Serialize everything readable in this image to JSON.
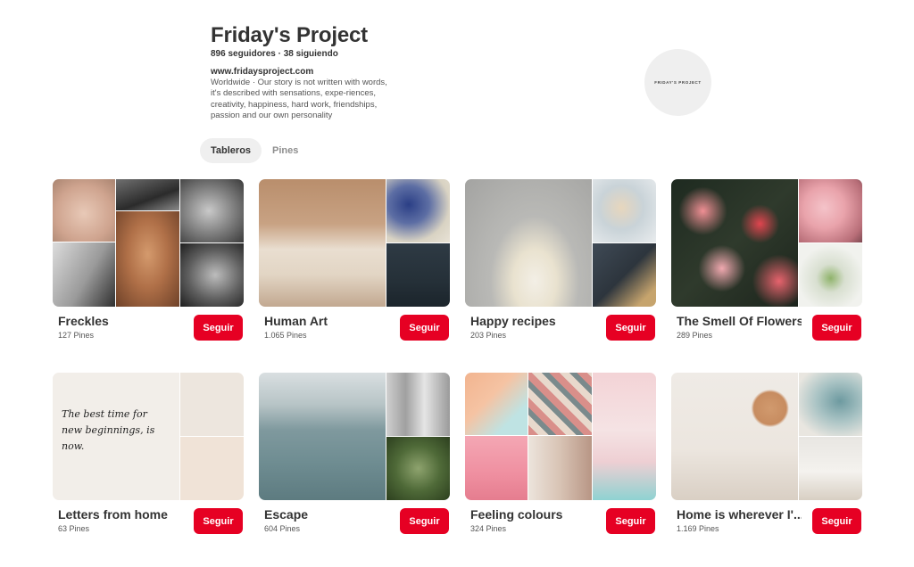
{
  "profile": {
    "name": "Friday's Project",
    "stats": "896 seguidores · 38 siguiendo",
    "website": "www.fridaysproject.com",
    "bio": "Worldwide  ·  Our story is not written with words, it's described with sensations, expe-riences, creativity, happiness, hard work, friendships, passion and our own personality",
    "avatar_text": "FRIDAY'S PROJECT"
  },
  "tabs": [
    {
      "label": "Tableros",
      "active": true
    },
    {
      "label": "Pines",
      "active": false
    }
  ],
  "follow_label": "Seguir",
  "boards": [
    {
      "title": "Freckles",
      "count": "127 Pines"
    },
    {
      "title": "Human Art",
      "count": "1.065 Pines"
    },
    {
      "title": "Happy recipes",
      "count": "203 Pines"
    },
    {
      "title": "The Smell Of Flowers",
      "count": "289 Pines"
    },
    {
      "title": "Letters from home",
      "count": "63 Pines"
    },
    {
      "title": "Escape",
      "count": "604 Pines"
    },
    {
      "title": "Feeling colours",
      "count": "324 Pines"
    },
    {
      "title": "Home is wherever I'...",
      "count": "1.169 Pines"
    }
  ],
  "cover_text": {
    "letters": "The best time for new beginnings, is now."
  },
  "colors": {
    "follow_button": "#e60023",
    "tab_active_bg": "#efefef"
  }
}
